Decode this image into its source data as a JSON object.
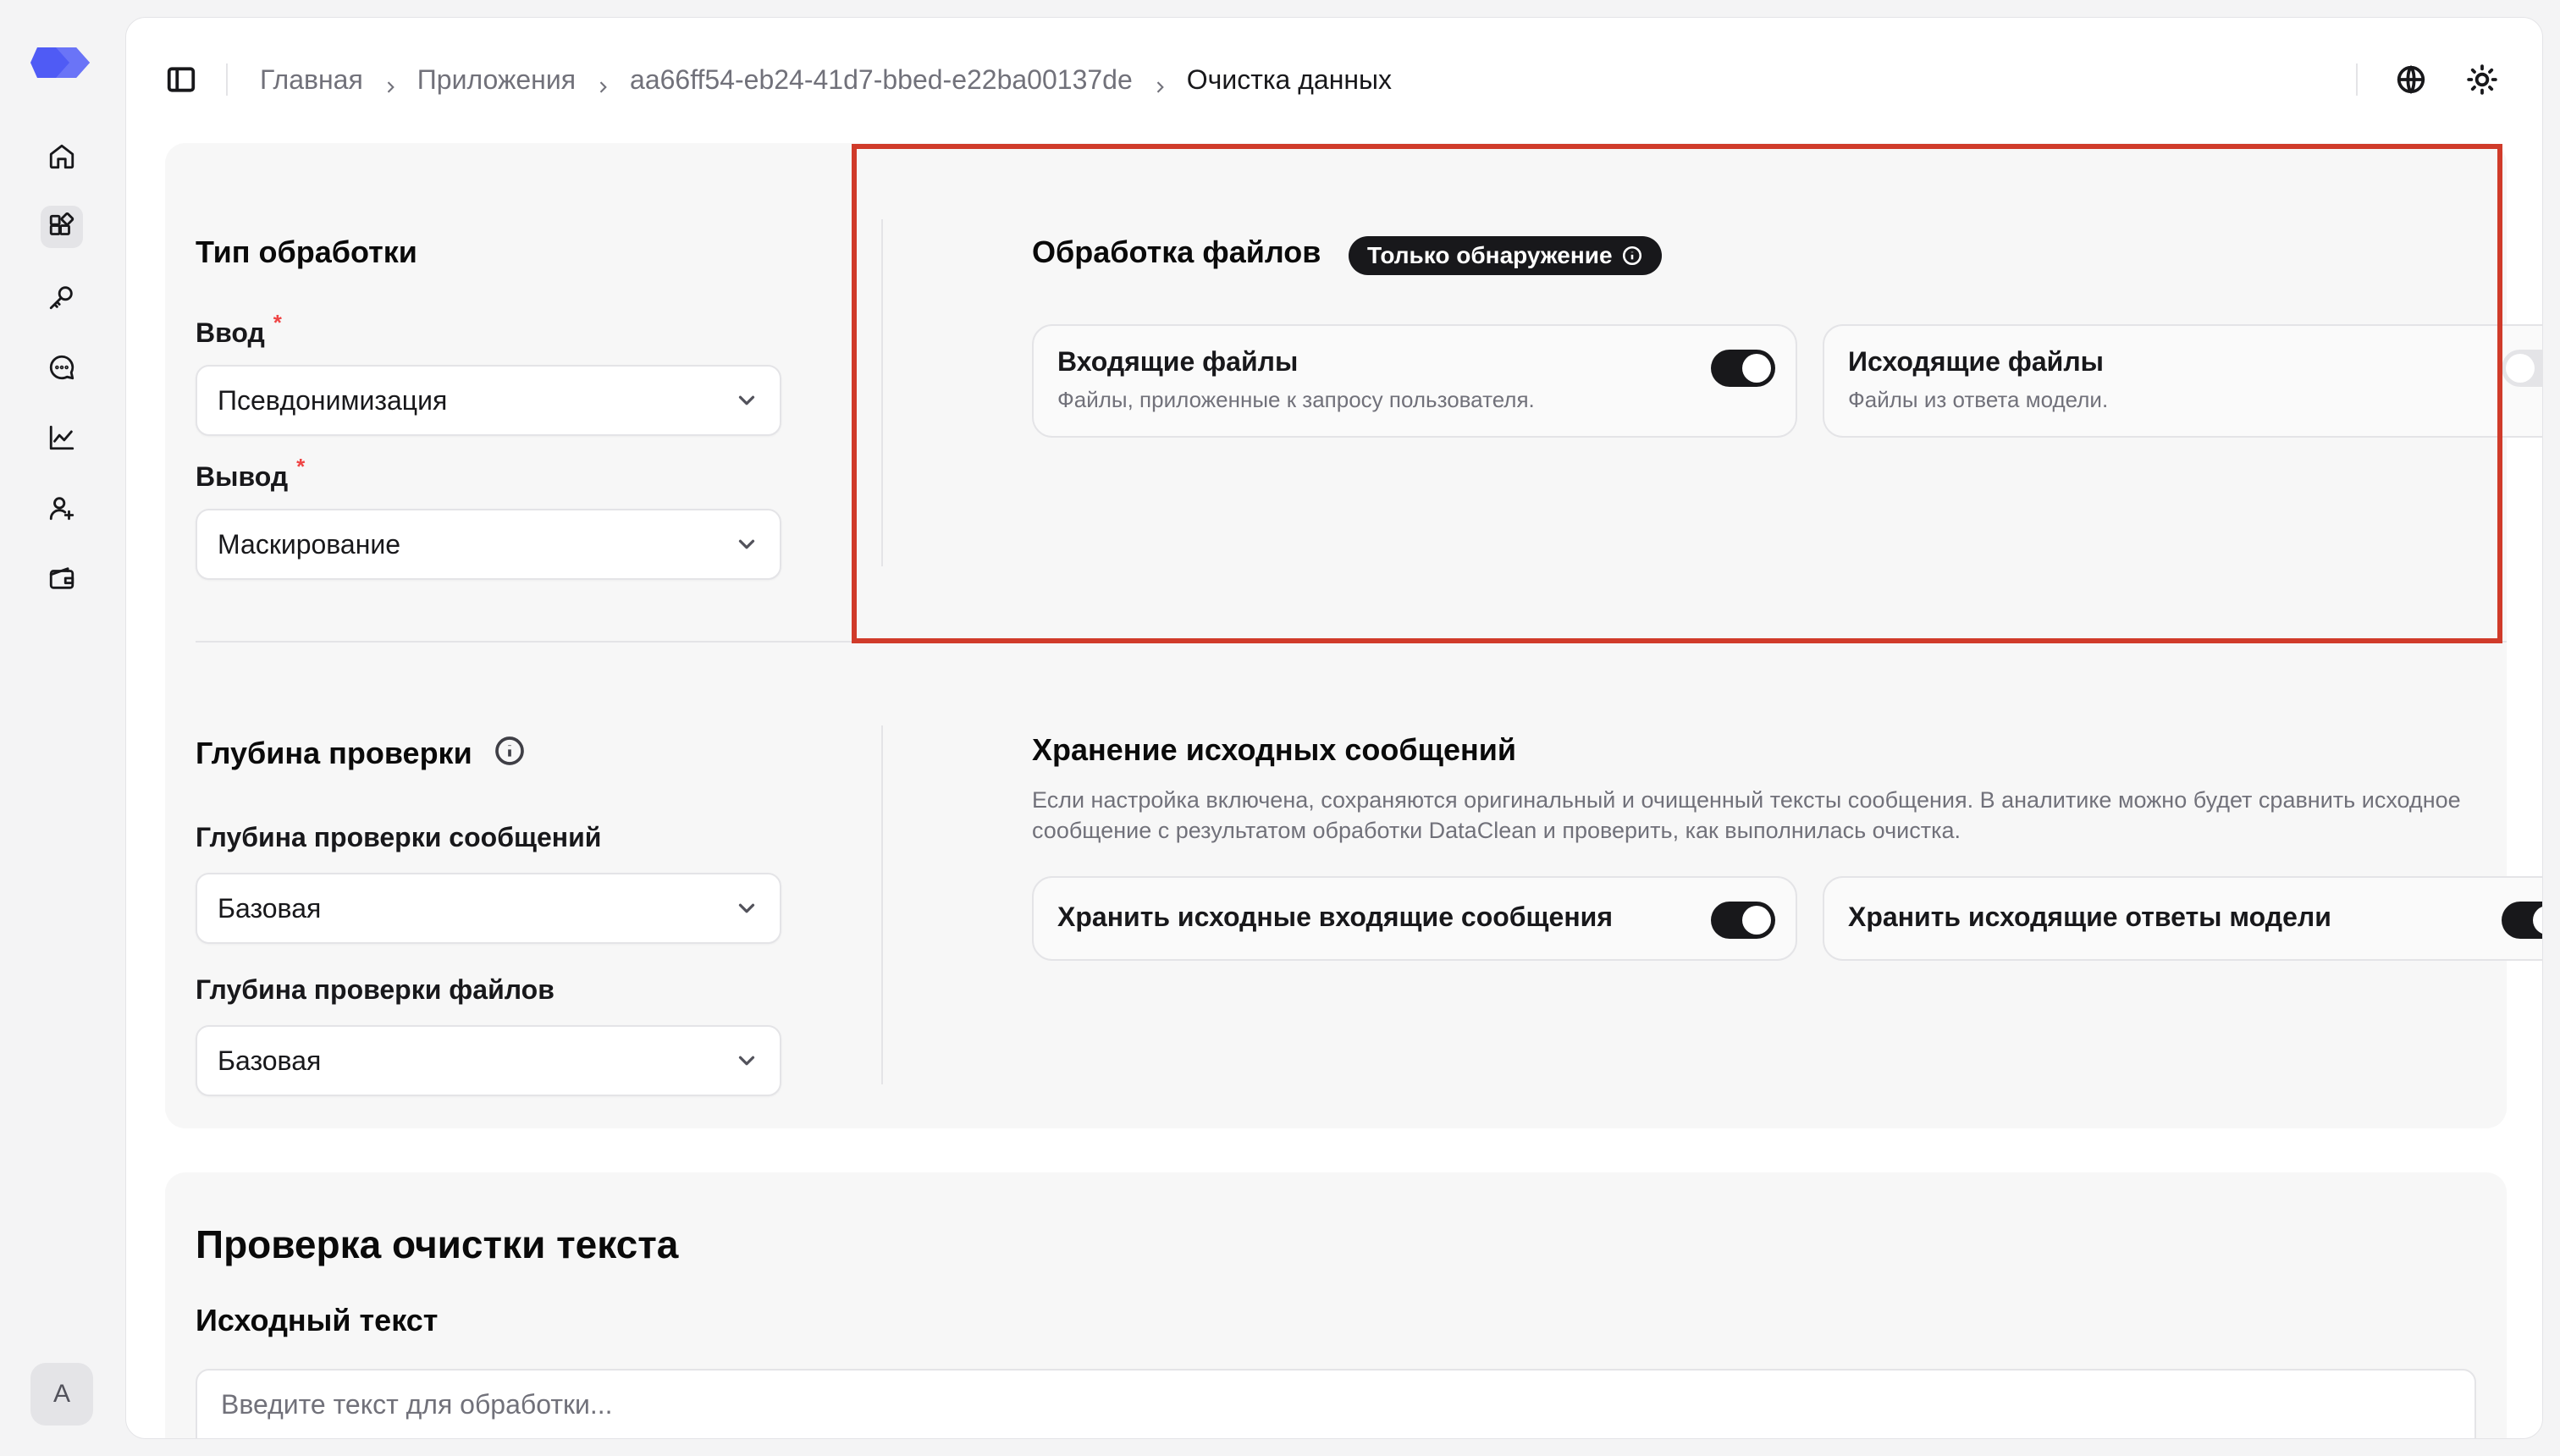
{
  "breadcrumb": {
    "items": [
      "Главная",
      "Приложения",
      "aa66ff54-eb24-41d7-bbed-e22ba00137de"
    ],
    "current": "Очистка данных"
  },
  "header_icons": [
    "globe-icon",
    "sun-icon"
  ],
  "rail": {
    "logo": "app-logo",
    "items": [
      "home-icon",
      "apps-icon",
      "key-icon",
      "chat-icon",
      "chart-icon",
      "user-plus-icon",
      "wallet-icon"
    ],
    "active_index": 1,
    "avatar_letter": "A"
  },
  "processing": {
    "title": "Тип обработки",
    "input_label": "Ввод",
    "input_value": "Псевдонимизация",
    "output_label": "Вывод",
    "output_value": "Маскирование",
    "required_mark": "*"
  },
  "files": {
    "title": "Обработка файлов",
    "badge": "Только обнаружение",
    "incoming": {
      "title": "Входящие файлы",
      "desc": "Файлы, приложенные к запросу пользователя.",
      "enabled": true
    },
    "outgoing": {
      "title": "Исходящие файлы",
      "desc": "Файлы из ответа модели.",
      "enabled": false
    }
  },
  "depth": {
    "title": "Глубина проверки",
    "messages_label": "Глубина проверки сообщений",
    "messages_value": "Базовая",
    "files_label": "Глубина проверки файлов",
    "files_value": "Базовая"
  },
  "storage": {
    "title": "Хранение исходных сообщений",
    "desc": "Если настройка включена, сохраняются оригинальный и очищенный тексты сообщения. В аналитике можно будет сравнить исходное сообщение с результатом обработки DataClean и проверить, как выполнилась очистка.",
    "incoming_label": "Хранить исходные входящие сообщения",
    "incoming_enabled": true,
    "outgoing_label": "Хранить исходящие ответы модели",
    "outgoing_enabled": true
  },
  "text_check": {
    "title": "Проверка очистки текста",
    "source_label": "Исходный текст",
    "placeholder": "Введите текст для обработки..."
  },
  "colors": {
    "accent": "#18181b",
    "highlight": "#d03b2a",
    "required": "#ef4444",
    "logo": "#4f5bf5"
  }
}
